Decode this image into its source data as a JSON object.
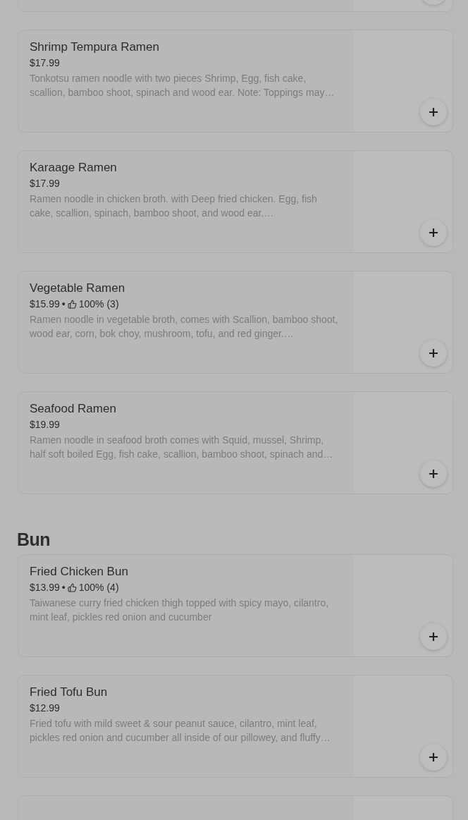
{
  "sections": [
    {
      "items": [
        {
          "kind": "cut-top"
        },
        {
          "name": "Shrimp Tempura Ramen",
          "price": "$17.99",
          "description": "Tonkotsu ramen noodle with two pieces Shrimp, Egg, fish cake, scallion, bamboo shoot, spinach and wood ear. Note: Toppings may…"
        },
        {
          "name": "Karaage Ramen",
          "price": "$17.99",
          "description": "Ramen noodle in chicken broth. with Deep fried chicken. Egg, fish cake, scallion, spinach, bamboo shoot, and wood ear.…"
        },
        {
          "name": "Vegetable Ramen",
          "price": "$15.99",
          "separator": "•",
          "rating": "100% (3)",
          "description": "Ramen noodle in vegetable broth, comes with Scallion, bamboo shoot, wood ear, corn, bok choy, mushroom, tofu, and red ginger.…"
        },
        {
          "name": "Seafood Ramen",
          "price": "$19.99",
          "description": "Ramen noodle in seafood broth comes with Squid, mussel, Shrimp, half soft boiled Egg, fish cake, scallion, bamboo shoot, spinach and…"
        }
      ]
    },
    {
      "title": "Bun",
      "items": [
        {
          "name": "Fried Chicken Bun",
          "price": "$13.99",
          "separator": "•",
          "rating": "100% (4)",
          "description": "Taiwanese curry fried chicken thigh topped with spicy mayo, cilantro, mint leaf, pickles red onion and cucumber"
        },
        {
          "name": "Fried Tofu Bun",
          "price": "$12.99",
          "description": "Fried tofu with mild sweet & sour peanut sauce, cilantro, mint leaf, pickles red onion and cucumber all inside of our pillowey, and fluffy…"
        },
        {
          "kind": "cut-bottom"
        }
      ]
    }
  ]
}
